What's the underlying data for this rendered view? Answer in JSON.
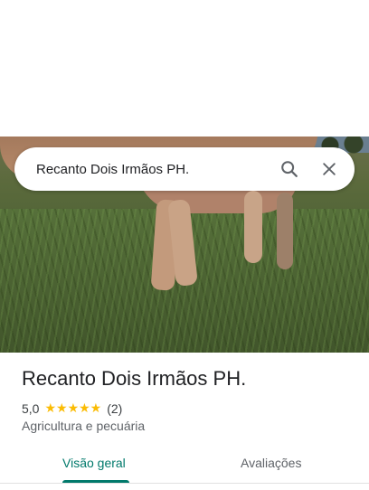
{
  "search": {
    "query": "Recanto Dois Irmãos PH."
  },
  "place": {
    "name": "Recanto Dois Irmãos PH.",
    "rating": "5,0",
    "stars": "★★★★★",
    "review_count": "(2)",
    "category": "Agricultura e pecuária"
  },
  "tabs": [
    {
      "label": "Visão geral",
      "active": true
    },
    {
      "label": "Avaliações",
      "active": false
    }
  ],
  "colors": {
    "accent": "#00796b",
    "star": "#fbbc04"
  },
  "icons": {
    "search": "search-icon",
    "close": "close-icon"
  }
}
